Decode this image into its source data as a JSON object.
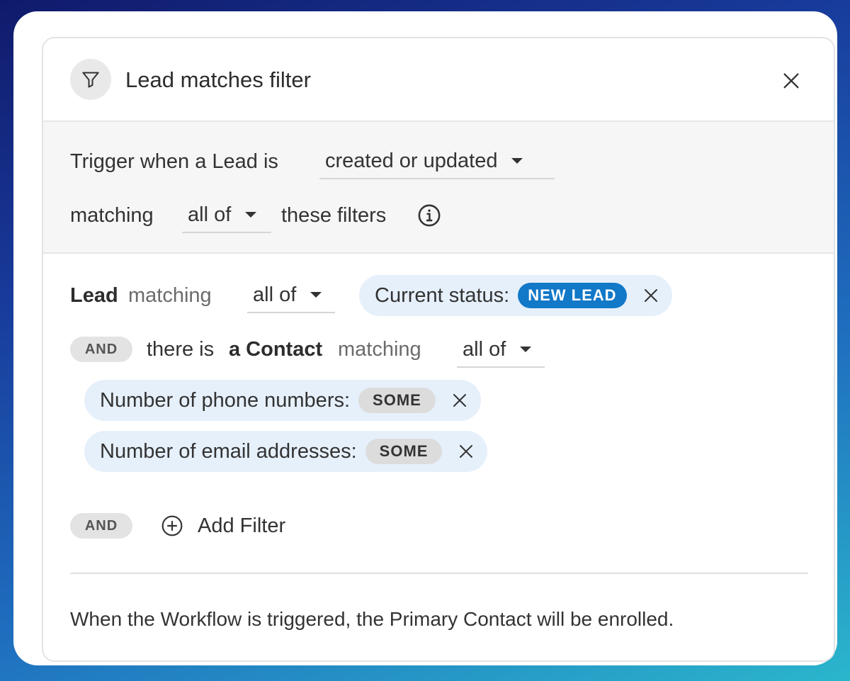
{
  "header": {
    "title": "Lead matches filter",
    "icon": "filter-icon",
    "close_icon": "close-icon"
  },
  "trigger": {
    "prefix": "Trigger when a Lead is",
    "event_selected": "created or updated",
    "matching_label": "matching",
    "match_mode_selected": "all of",
    "suffix": "these filters",
    "info_icon": "info-icon"
  },
  "lead_filter": {
    "entity": "Lead",
    "matching_label": "matching",
    "match_mode_selected": "all of",
    "chips": [
      {
        "label": "Current status:",
        "value": "NEW LEAD",
        "value_color": "#1278c8"
      }
    ]
  },
  "contact_filter": {
    "and_label": "AND",
    "prefix": "there is",
    "entity": "a Contact",
    "matching_label": "matching",
    "match_mode_selected": "all of",
    "chips": [
      {
        "label": "Number of phone numbers:",
        "value": "SOME"
      },
      {
        "label": "Number of email addresses:",
        "value": "SOME"
      }
    ]
  },
  "add_filter": {
    "and_label": "AND",
    "label": "Add Filter",
    "icon": "plus-circle-icon"
  },
  "footer": {
    "note": "When the Workflow is triggered, the Primary Contact will be enrolled."
  },
  "colors": {
    "accent": "#1278c8",
    "chip_background": "#e6f0fb",
    "section_background": "#f6f6f6"
  }
}
